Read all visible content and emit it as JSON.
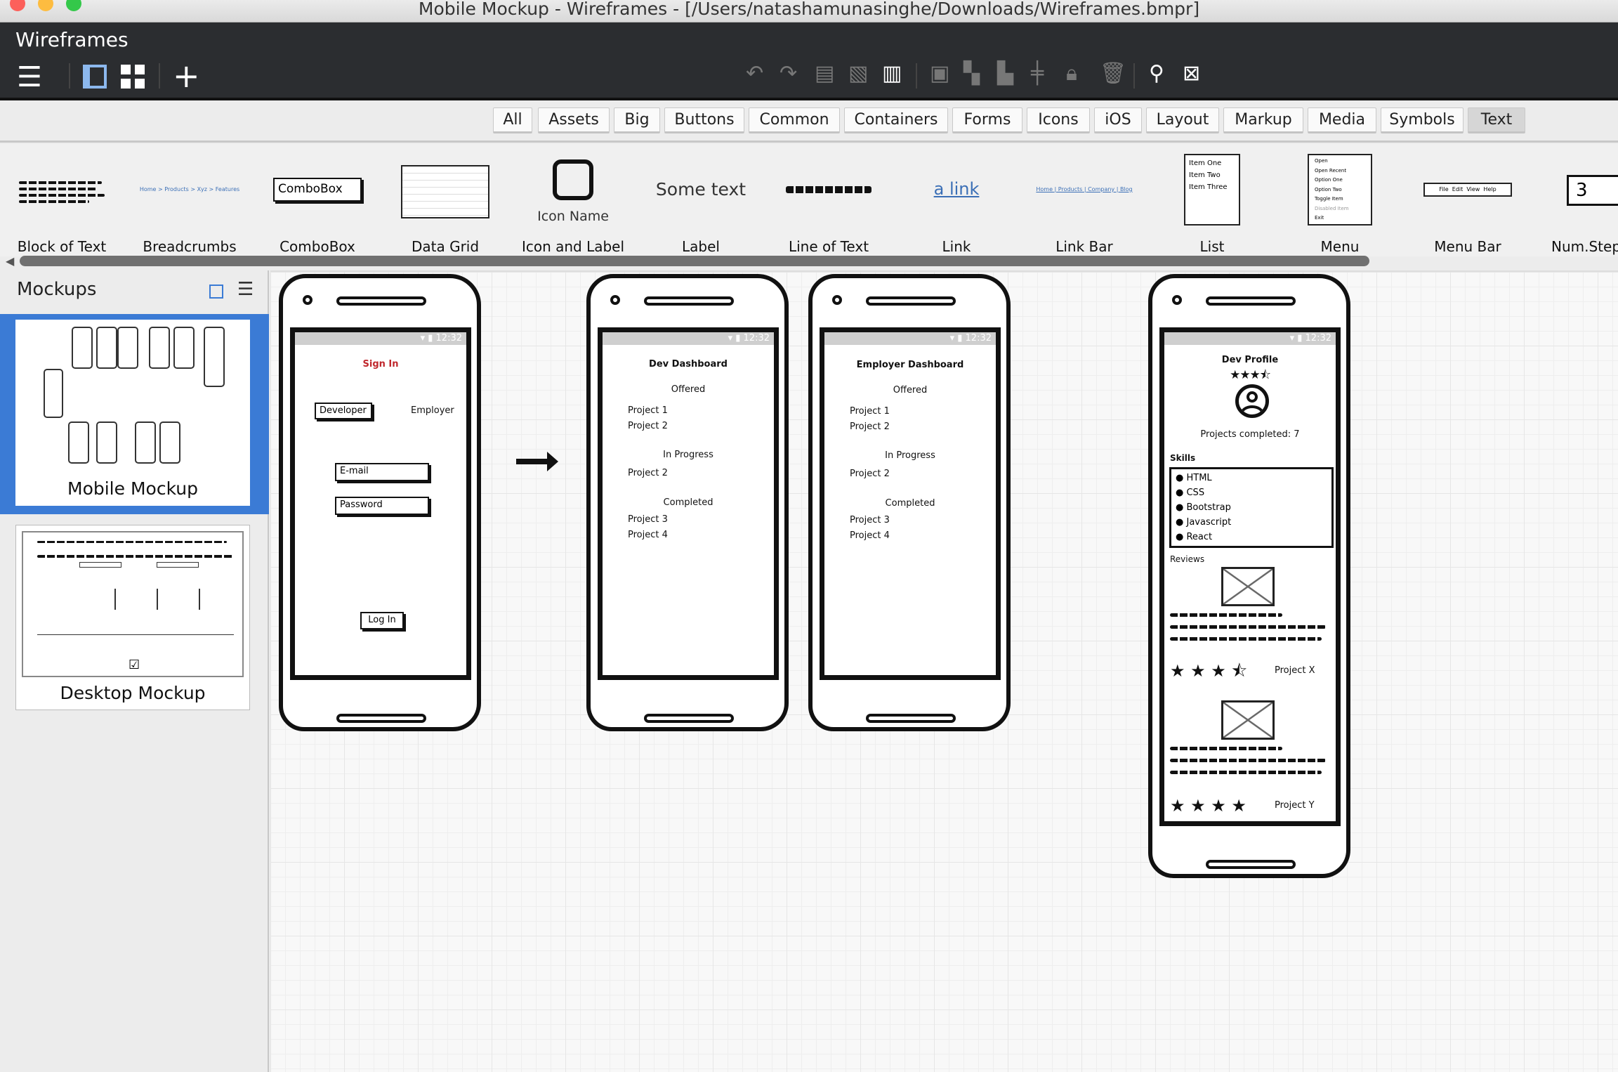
{
  "window": {
    "title": "Mobile Mockup - Wireframes - [/Users/natashamunasinghe/Downloads/Wireframes.bmpr]"
  },
  "app": {
    "title": "Wireframes"
  },
  "toolbar": {
    "left_icons": [
      "menu-icon",
      "single-panel-icon",
      "grid-view-icon",
      "add-icon"
    ],
    "right_icons": [
      "undo-icon",
      "redo-icon",
      "copy-icon",
      "duplicate-icon",
      "paste-icon",
      "group-icon",
      "ungroup-icon",
      "arrange-icon",
      "align-icon",
      "lock-icon",
      "delete-icon",
      "find-icon",
      "clear-icon"
    ]
  },
  "tabs": [
    {
      "label": "All"
    },
    {
      "label": "Assets"
    },
    {
      "label": "Big"
    },
    {
      "label": "Buttons"
    },
    {
      "label": "Common"
    },
    {
      "label": "Containers"
    },
    {
      "label": "Forms"
    },
    {
      "label": "Icons"
    },
    {
      "label": "iOS"
    },
    {
      "label": "Layout"
    },
    {
      "label": "Markup"
    },
    {
      "label": "Media"
    },
    {
      "label": "Symbols"
    },
    {
      "label": "Text",
      "selected": true
    }
  ],
  "library": [
    {
      "label": "Block of Text"
    },
    {
      "label": "Breadcrumbs",
      "preview": "Home > Products > Xyz > Features"
    },
    {
      "label": "ComboBox",
      "preview": "ComboBox"
    },
    {
      "label": "Data Grid"
    },
    {
      "label": "Icon and Label",
      "preview": "Icon Name"
    },
    {
      "label": "Label",
      "preview": "Some text"
    },
    {
      "label": "Line of Text"
    },
    {
      "label": "Link",
      "preview": "a link"
    },
    {
      "label": "Link Bar",
      "preview": "Home | Products | Company | Blog"
    },
    {
      "label": "List",
      "preview": [
        "Item One",
        "Item Two",
        "Item Three"
      ]
    },
    {
      "label": "Menu",
      "preview": [
        "Open",
        "Open Recent",
        "Option One",
        "Option Two",
        "Toggle Item",
        "Disabled Item",
        "Exit"
      ]
    },
    {
      "label": "Menu Bar",
      "preview": "File  Edit  View  Help"
    },
    {
      "label": "Num.Step",
      "preview": "3"
    }
  ],
  "mockups_panel": {
    "title": "Mockups",
    "items": [
      {
        "label": "Mobile Mockup",
        "selected": true
      },
      {
        "label": "Desktop Mockup"
      }
    ]
  },
  "status_time": "12:32",
  "screens": {
    "signin": {
      "title": "Sign In",
      "title_color": "#c0282d",
      "developer": "Developer",
      "employer": "Employer",
      "email": "E-mail",
      "password": "Password",
      "login": "Log In"
    },
    "dev_dashboard": {
      "title": "Dev Dashboard",
      "offered": "Offered",
      "offered_items": [
        "Project 1",
        "Project 2"
      ],
      "in_progress": "In Progress",
      "in_progress_items": [
        "Project 2"
      ],
      "completed": "Completed",
      "completed_items": [
        "Project 3",
        "Project 4"
      ]
    },
    "employer_dashboard": {
      "title": "Employer Dashboard",
      "offered": "Offered",
      "offered_items": [
        "Project 1",
        "Project 2"
      ],
      "in_progress": "In Progress",
      "in_progress_items": [
        "Project 2"
      ],
      "completed": "Completed",
      "completed_items": [
        "Project 3",
        "Project 4"
      ]
    },
    "dev_profile": {
      "title": "Dev Profile",
      "rating": 3.5,
      "projects_completed": "Projects completed: 7",
      "skills_label": "Skills",
      "skills": [
        "HTML",
        "CSS",
        "Bootstrap",
        "Javascript",
        "React"
      ],
      "reviews_label": "Reviews",
      "reviews": [
        {
          "project": "Project X",
          "rating": 3.5
        },
        {
          "project": "Project Y",
          "rating": 4
        }
      ]
    }
  },
  "colors": {
    "header_bg": "#2b2d30",
    "selection": "#3b7bd5",
    "accent_link": "#3b6fb6"
  }
}
